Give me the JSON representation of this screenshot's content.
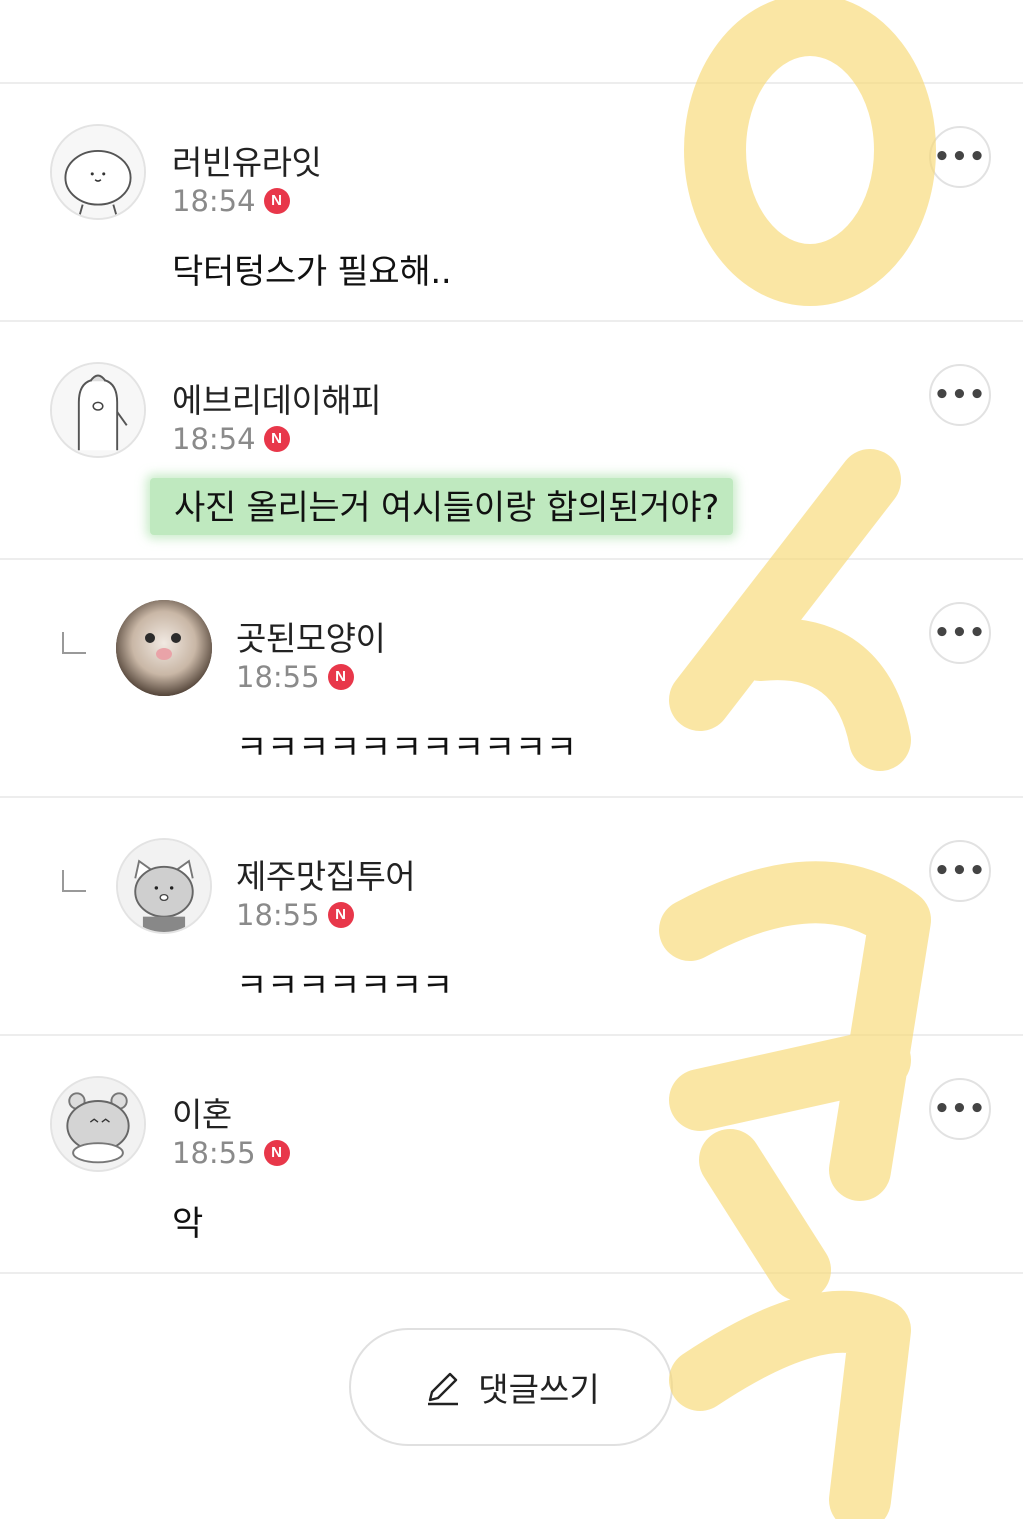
{
  "comments": [
    {
      "name": "러빈유라잇",
      "time": "18:54",
      "badge": "N",
      "text": "닥터텅스가 필요해..",
      "reply": false
    },
    {
      "name": "에브리데이해피",
      "time": "18:54",
      "badge": "N",
      "text": "사진 올리는거 여시들이랑 합의된거야?",
      "reply": false,
      "highlight_color": "#bfe9bf"
    },
    {
      "name": "곳된모양이",
      "time": "18:55",
      "badge": "N",
      "text": "ㅋㅋㅋㅋㅋㅋㅋㅋㅋㅋㅋ",
      "reply": true
    },
    {
      "name": "제주맛집투어",
      "time": "18:55",
      "badge": "N",
      "text": "ㅋㅋㅋㅋㅋㅋㅋ",
      "reply": true
    },
    {
      "name": "이혼",
      "time": "18:55",
      "badge": "N",
      "text": "악",
      "reply": false
    }
  ],
  "more_label": "•••",
  "write_button": {
    "label": "댓글쓰기",
    "icon": "pencil-icon"
  },
  "colors": {
    "badge": "#e8374a",
    "divider": "#ededed",
    "highlight": "#bfe9bf",
    "overlay": "#f7d873"
  }
}
